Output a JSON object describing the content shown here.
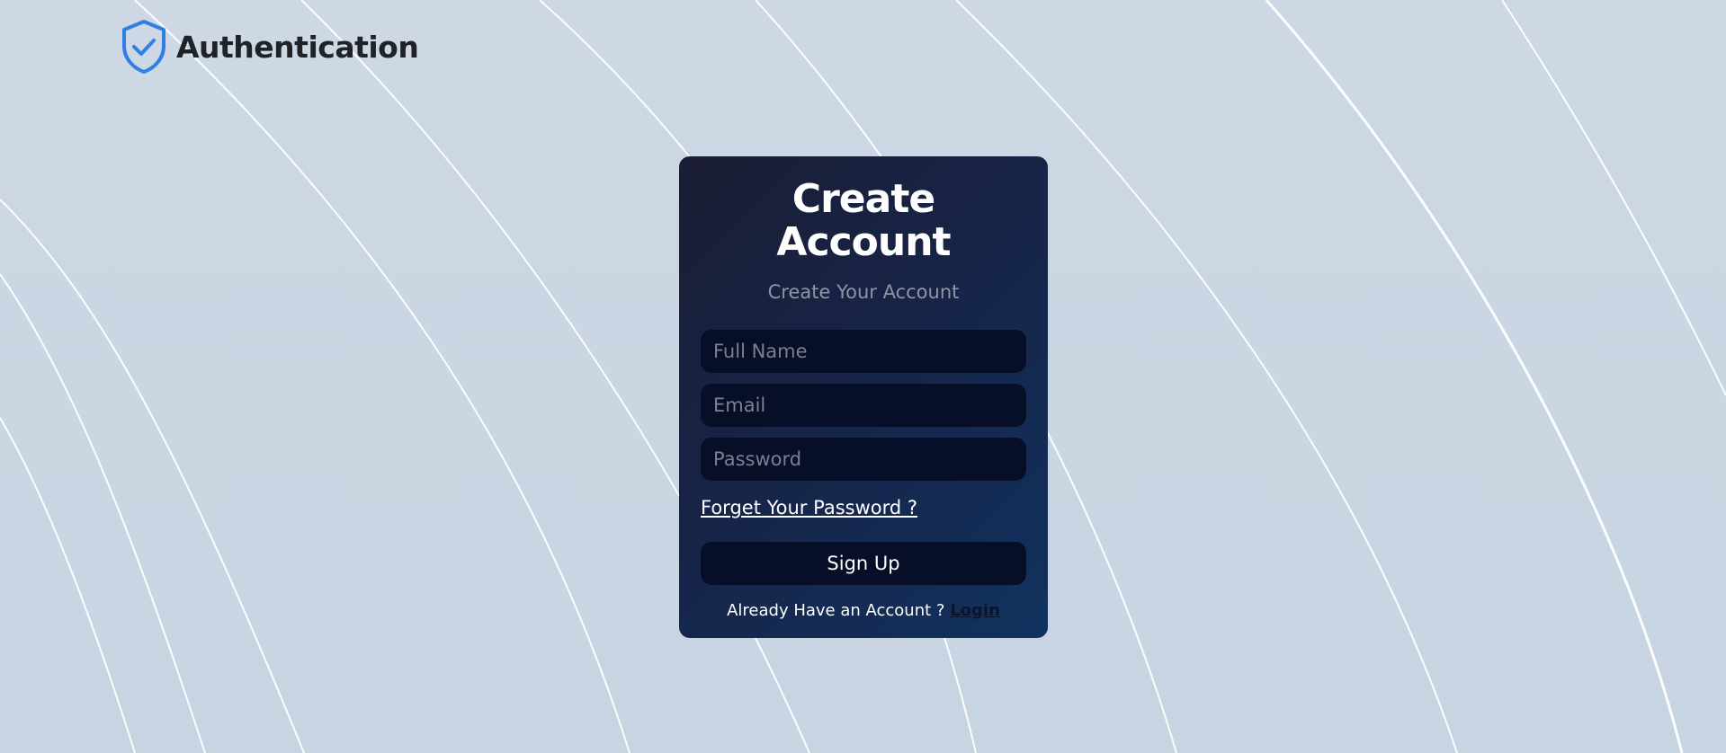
{
  "brand": {
    "title": "Authentication",
    "icon": "shield-check-icon",
    "icon_color": "#2f7fe6"
  },
  "card": {
    "title": "Create Account",
    "subtitle": "Create Your Account",
    "fields": {
      "full_name": {
        "placeholder": "Full Name",
        "value": ""
      },
      "email": {
        "placeholder": "Email",
        "value": ""
      },
      "password": {
        "placeholder": "Password",
        "value": ""
      }
    },
    "forgot_link": "Forget Your Password ?",
    "submit_label": "Sign Up",
    "login_prompt": "Already Have an Account ?",
    "login_link": "Login"
  },
  "colors": {
    "background": "#cbd6e2",
    "card_start": "#1b1d33",
    "card_end": "#11325f",
    "field_bg": "#060f27",
    "placeholder": "#7a808d",
    "subtitle": "#8f96a3"
  }
}
